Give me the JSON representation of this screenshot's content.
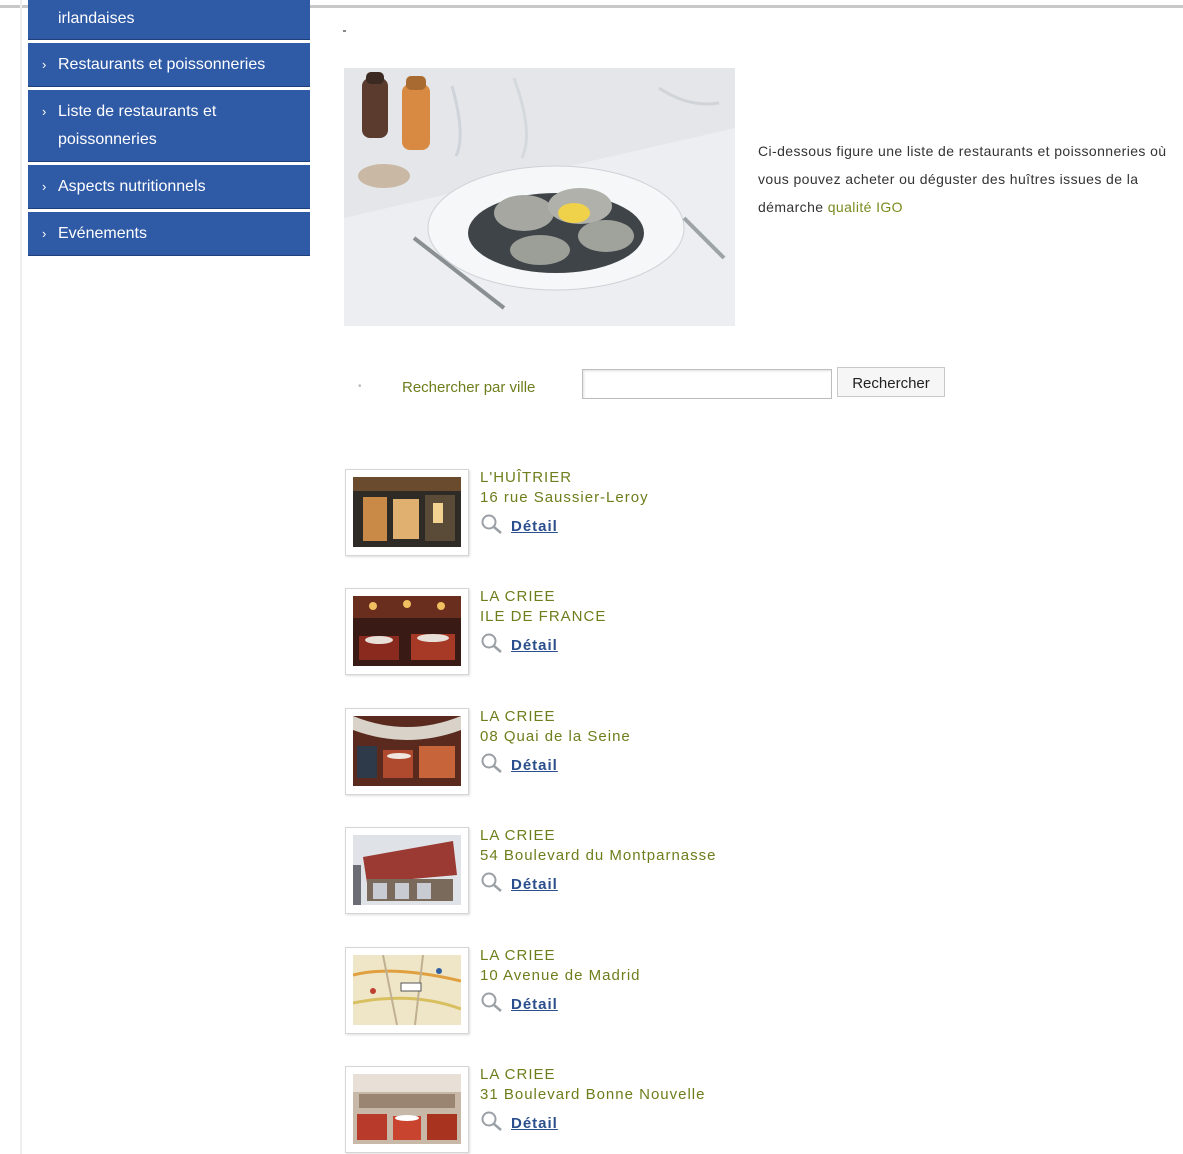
{
  "sidebar": {
    "items": [
      {
        "label": "irlandaises"
      },
      {
        "label": "Restaurants et poissonneries"
      },
      {
        "label": "Liste de restaurants et poissonneries"
      },
      {
        "label": "Aspects nutritionnels"
      },
      {
        "label": "Evénements"
      }
    ]
  },
  "intro": {
    "text_before": "Ci-dessous figure une liste de restaurants et poissonneries où vous pouvez acheter ou déguster des huîtres issues de la démarche ",
    "highlight": "qualité IGO"
  },
  "search": {
    "label": "Rechercher par ville",
    "input_value": "",
    "button_label": "Rechercher"
  },
  "listings": [
    {
      "name": "L'HUÎTRIER",
      "address": "16 rue Saussier-Leroy",
      "detail_label": "Détail"
    },
    {
      "name": "LA CRIEE",
      "address": "ILE DE FRANCE",
      "detail_label": "Détail"
    },
    {
      "name": "LA CRIEE",
      "address": "08 Quai de la Seine",
      "detail_label": "Détail"
    },
    {
      "name": "LA CRIEE",
      "address": "54 Boulevard du Montparnasse",
      "detail_label": "Détail"
    },
    {
      "name": "LA CRIEE",
      "address": "10 Avenue de Madrid",
      "detail_label": "Détail"
    },
    {
      "name": "LA CRIEE",
      "address": "31 Boulevard Bonne Nouvelle",
      "detail_label": "Détail"
    }
  ],
  "colors": {
    "nav_bg": "#2f5aa6",
    "accent_text": "#6e7e1c",
    "link": "#2a4f8c"
  }
}
